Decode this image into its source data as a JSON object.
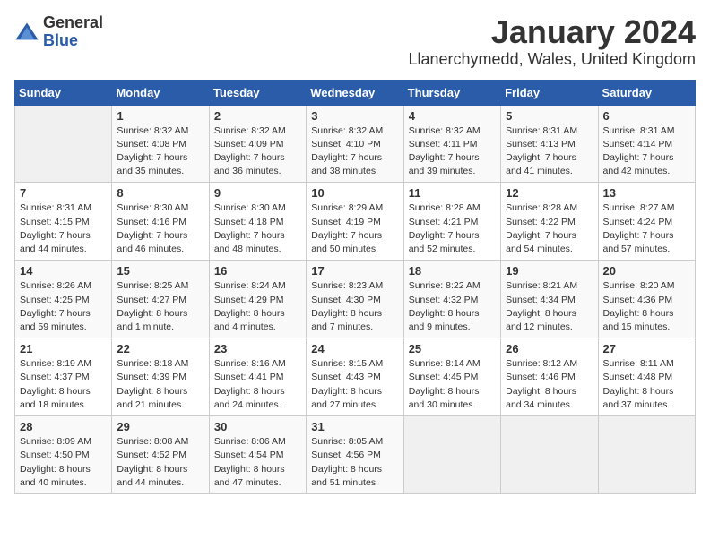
{
  "header": {
    "logo_general": "General",
    "logo_blue": "Blue",
    "title": "January 2024",
    "subtitle": "Llanerchymedd, Wales, United Kingdom"
  },
  "days_of_week": [
    "Sunday",
    "Monday",
    "Tuesday",
    "Wednesday",
    "Thursday",
    "Friday",
    "Saturday"
  ],
  "weeks": [
    [
      {
        "day": "",
        "sunrise": "",
        "sunset": "",
        "daylight": ""
      },
      {
        "day": "1",
        "sunrise": "Sunrise: 8:32 AM",
        "sunset": "Sunset: 4:08 PM",
        "daylight": "Daylight: 7 hours and 35 minutes."
      },
      {
        "day": "2",
        "sunrise": "Sunrise: 8:32 AM",
        "sunset": "Sunset: 4:09 PM",
        "daylight": "Daylight: 7 hours and 36 minutes."
      },
      {
        "day": "3",
        "sunrise": "Sunrise: 8:32 AM",
        "sunset": "Sunset: 4:10 PM",
        "daylight": "Daylight: 7 hours and 38 minutes."
      },
      {
        "day": "4",
        "sunrise": "Sunrise: 8:32 AM",
        "sunset": "Sunset: 4:11 PM",
        "daylight": "Daylight: 7 hours and 39 minutes."
      },
      {
        "day": "5",
        "sunrise": "Sunrise: 8:31 AM",
        "sunset": "Sunset: 4:13 PM",
        "daylight": "Daylight: 7 hours and 41 minutes."
      },
      {
        "day": "6",
        "sunrise": "Sunrise: 8:31 AM",
        "sunset": "Sunset: 4:14 PM",
        "daylight": "Daylight: 7 hours and 42 minutes."
      }
    ],
    [
      {
        "day": "7",
        "sunrise": "Sunrise: 8:31 AM",
        "sunset": "Sunset: 4:15 PM",
        "daylight": "Daylight: 7 hours and 44 minutes."
      },
      {
        "day": "8",
        "sunrise": "Sunrise: 8:30 AM",
        "sunset": "Sunset: 4:16 PM",
        "daylight": "Daylight: 7 hours and 46 minutes."
      },
      {
        "day": "9",
        "sunrise": "Sunrise: 8:30 AM",
        "sunset": "Sunset: 4:18 PM",
        "daylight": "Daylight: 7 hours and 48 minutes."
      },
      {
        "day": "10",
        "sunrise": "Sunrise: 8:29 AM",
        "sunset": "Sunset: 4:19 PM",
        "daylight": "Daylight: 7 hours and 50 minutes."
      },
      {
        "day": "11",
        "sunrise": "Sunrise: 8:28 AM",
        "sunset": "Sunset: 4:21 PM",
        "daylight": "Daylight: 7 hours and 52 minutes."
      },
      {
        "day": "12",
        "sunrise": "Sunrise: 8:28 AM",
        "sunset": "Sunset: 4:22 PM",
        "daylight": "Daylight: 7 hours and 54 minutes."
      },
      {
        "day": "13",
        "sunrise": "Sunrise: 8:27 AM",
        "sunset": "Sunset: 4:24 PM",
        "daylight": "Daylight: 7 hours and 57 minutes."
      }
    ],
    [
      {
        "day": "14",
        "sunrise": "Sunrise: 8:26 AM",
        "sunset": "Sunset: 4:25 PM",
        "daylight": "Daylight: 7 hours and 59 minutes."
      },
      {
        "day": "15",
        "sunrise": "Sunrise: 8:25 AM",
        "sunset": "Sunset: 4:27 PM",
        "daylight": "Daylight: 8 hours and 1 minute."
      },
      {
        "day": "16",
        "sunrise": "Sunrise: 8:24 AM",
        "sunset": "Sunset: 4:29 PM",
        "daylight": "Daylight: 8 hours and 4 minutes."
      },
      {
        "day": "17",
        "sunrise": "Sunrise: 8:23 AM",
        "sunset": "Sunset: 4:30 PM",
        "daylight": "Daylight: 8 hours and 7 minutes."
      },
      {
        "day": "18",
        "sunrise": "Sunrise: 8:22 AM",
        "sunset": "Sunset: 4:32 PM",
        "daylight": "Daylight: 8 hours and 9 minutes."
      },
      {
        "day": "19",
        "sunrise": "Sunrise: 8:21 AM",
        "sunset": "Sunset: 4:34 PM",
        "daylight": "Daylight: 8 hours and 12 minutes."
      },
      {
        "day": "20",
        "sunrise": "Sunrise: 8:20 AM",
        "sunset": "Sunset: 4:36 PM",
        "daylight": "Daylight: 8 hours and 15 minutes."
      }
    ],
    [
      {
        "day": "21",
        "sunrise": "Sunrise: 8:19 AM",
        "sunset": "Sunset: 4:37 PM",
        "daylight": "Daylight: 8 hours and 18 minutes."
      },
      {
        "day": "22",
        "sunrise": "Sunrise: 8:18 AM",
        "sunset": "Sunset: 4:39 PM",
        "daylight": "Daylight: 8 hours and 21 minutes."
      },
      {
        "day": "23",
        "sunrise": "Sunrise: 8:16 AM",
        "sunset": "Sunset: 4:41 PM",
        "daylight": "Daylight: 8 hours and 24 minutes."
      },
      {
        "day": "24",
        "sunrise": "Sunrise: 8:15 AM",
        "sunset": "Sunset: 4:43 PM",
        "daylight": "Daylight: 8 hours and 27 minutes."
      },
      {
        "day": "25",
        "sunrise": "Sunrise: 8:14 AM",
        "sunset": "Sunset: 4:45 PM",
        "daylight": "Daylight: 8 hours and 30 minutes."
      },
      {
        "day": "26",
        "sunrise": "Sunrise: 8:12 AM",
        "sunset": "Sunset: 4:46 PM",
        "daylight": "Daylight: 8 hours and 34 minutes."
      },
      {
        "day": "27",
        "sunrise": "Sunrise: 8:11 AM",
        "sunset": "Sunset: 4:48 PM",
        "daylight": "Daylight: 8 hours and 37 minutes."
      }
    ],
    [
      {
        "day": "28",
        "sunrise": "Sunrise: 8:09 AM",
        "sunset": "Sunset: 4:50 PM",
        "daylight": "Daylight: 8 hours and 40 minutes."
      },
      {
        "day": "29",
        "sunrise": "Sunrise: 8:08 AM",
        "sunset": "Sunset: 4:52 PM",
        "daylight": "Daylight: 8 hours and 44 minutes."
      },
      {
        "day": "30",
        "sunrise": "Sunrise: 8:06 AM",
        "sunset": "Sunset: 4:54 PM",
        "daylight": "Daylight: 8 hours and 47 minutes."
      },
      {
        "day": "31",
        "sunrise": "Sunrise: 8:05 AM",
        "sunset": "Sunset: 4:56 PM",
        "daylight": "Daylight: 8 hours and 51 minutes."
      },
      {
        "day": "",
        "sunrise": "",
        "sunset": "",
        "daylight": ""
      },
      {
        "day": "",
        "sunrise": "",
        "sunset": "",
        "daylight": ""
      },
      {
        "day": "",
        "sunrise": "",
        "sunset": "",
        "daylight": ""
      }
    ]
  ]
}
